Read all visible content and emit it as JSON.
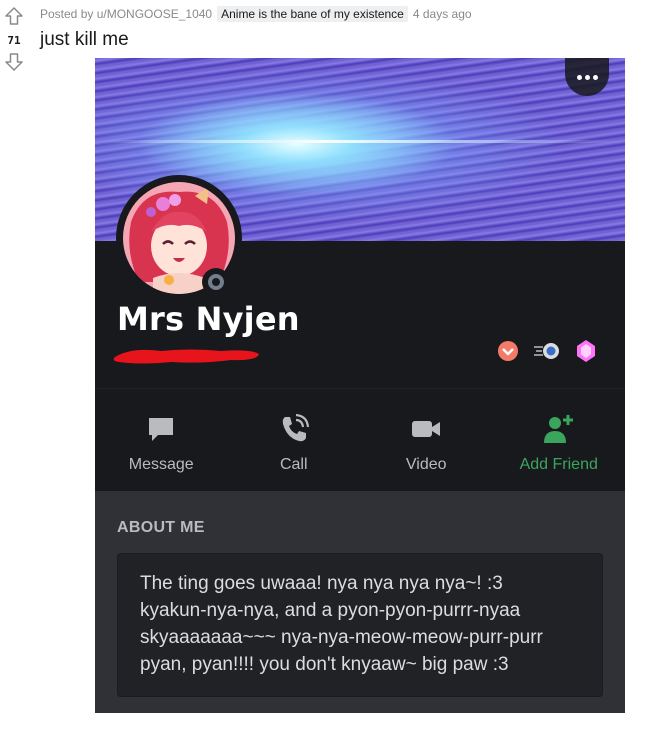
{
  "post": {
    "score": "71",
    "posted_by": "Posted by u/MONGOOSE_1040",
    "flair": "Anime is the bane of my existence",
    "time": "4 days ago",
    "title": "just kill me"
  },
  "profile": {
    "display_name": "Mrs Nyjen",
    "status": "offline",
    "badges": [
      "hypesquad-brilliance-icon",
      "nitro-icon",
      "boost-icon"
    ]
  },
  "actions": [
    {
      "label": "Message",
      "icon": "message-icon"
    },
    {
      "label": "Call",
      "icon": "call-icon"
    },
    {
      "label": "Video",
      "icon": "video-icon"
    },
    {
      "label": "Add Friend",
      "icon": "add-friend-icon"
    }
  ],
  "about": {
    "header": "ABOUT ME",
    "text": "The ting goes uwaaa! nya nya nya nya~! :3\nkyakun-nya-nya, and a pyon-pyon-purrr-nyaa\nskyaaaaaaa~~~ nya-nya-meow-meow-purr-purr\npyan, pyan!!!! you don't knyaaw~ big paw :3"
  },
  "colors": {
    "discord_bg": "#18191c",
    "about_bg": "#2f3136",
    "add_friend_green": "#3ba55d",
    "redaction": "#e8141c"
  }
}
